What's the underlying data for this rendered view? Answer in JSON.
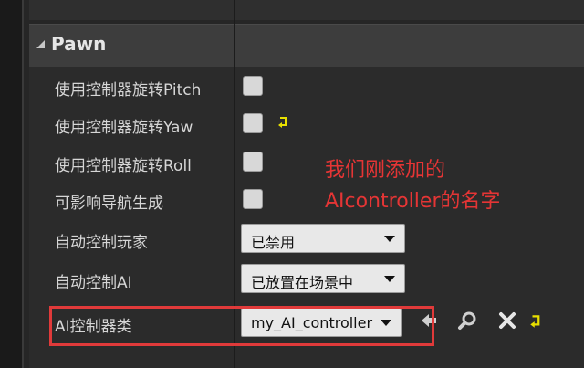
{
  "section": {
    "title": "Pawn"
  },
  "rows": [
    {
      "label": "使用控制器旋转Pitch"
    },
    {
      "label": "使用控制器旋转Yaw"
    },
    {
      "label": "使用控制器旋转Roll"
    },
    {
      "label": "可影响导航生成"
    },
    {
      "label": "自动控制玩家",
      "value": "已禁用"
    },
    {
      "label": "自动控制AI",
      "value": "已放置在场景中"
    },
    {
      "label": "AI控制器类",
      "value": "my_AI_controller"
    }
  ],
  "annotation": {
    "line1": "我们刚添加的",
    "line2": "AIcontroller的名字"
  },
  "colors": {
    "annotation": "#e53535",
    "reset_arrow": "#e8e000"
  }
}
